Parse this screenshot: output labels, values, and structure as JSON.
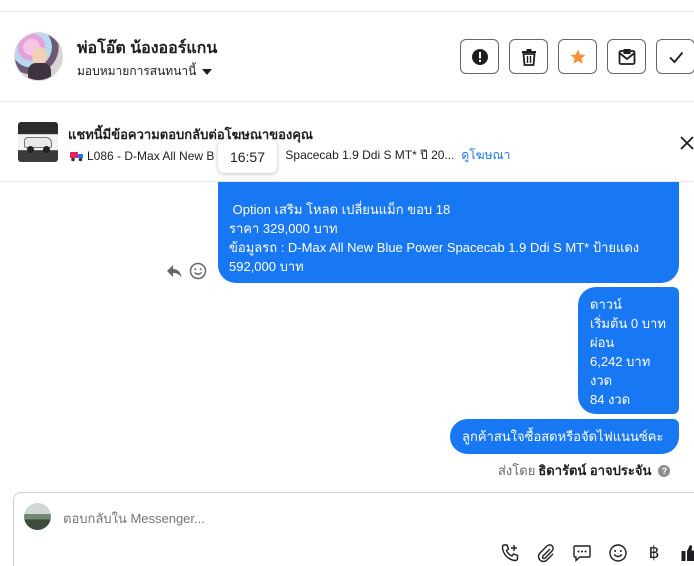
{
  "header": {
    "name": "พ่อโอ๊ต น้องออร์แกน",
    "assign_label": "มอบหมายการสนทนานี้",
    "actions": [
      "flag-icon",
      "trash-icon",
      "star-icon",
      "mark-unread-icon",
      "check-icon"
    ],
    "star_color": "#f7923b"
  },
  "ad": {
    "title": "แชทนี้มีข้อความตอบกลับต่อโฆษณาของคุณ",
    "subtitle_left": "L086 - D-Max All New B",
    "subtitle_right": "Spacecab 1.9 Ddi S MT* ปี 20...",
    "link": "ดูโฆษณา"
  },
  "tooltip": {
    "time": "16:57"
  },
  "messages": {
    "m1": [
      " Option เสริม โหลด เปลี่ยนแม็ก ขอบ 18",
      "ราคา 329,000 บาท",
      "ข้อมูลรถ : D-Max All New Blue Power Spacecab 1.9 Ddi S MT* ป้ายแดง",
      "592,000 บาท"
    ],
    "m2": [
      "ดาวน์",
      "เริ่มต้น 0 บาท",
      "ผ่อน",
      "6,242 บาท",
      "งวด",
      "84 งวด"
    ],
    "m3": "ลูกค้าสนใจซื้อสดหรือจัดไฟแนนซ์คะ"
  },
  "sent_by": {
    "prefix": "ส่งโดย",
    "name": "ธิดารัตน์ อาจประจัน"
  },
  "composer": {
    "placeholder": "ตอบกลับใน Messenger..."
  },
  "colors": {
    "bubble": "#1877f2",
    "link": "#1877f2"
  }
}
